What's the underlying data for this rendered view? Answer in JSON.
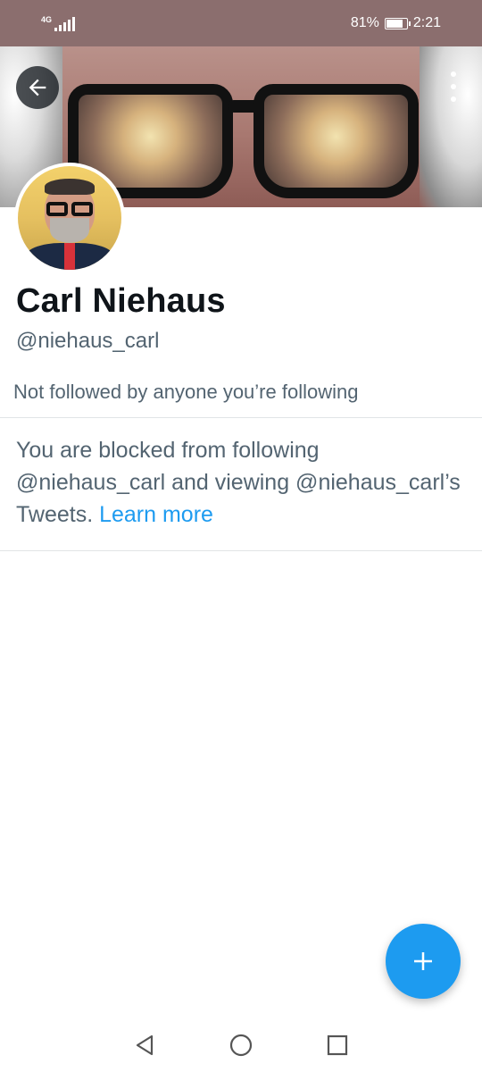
{
  "status_bar": {
    "network": "4G",
    "battery_percent": "81%",
    "battery_level": 0.81,
    "time": "2:21"
  },
  "profile": {
    "name": "Carl Niehaus",
    "handle": "@niehaus_carl",
    "followed_by_text": "Not followed by anyone you’re following"
  },
  "blocked_notice": {
    "message": "You are blocked from following @niehaus_carl and viewing @niehaus_carl’s Tweets.",
    "link_text": "Learn more"
  },
  "colors": {
    "accent": "#1d9bf0",
    "status_bar_bg": "#8b6e6e",
    "secondary_text": "#536471",
    "primary_text": "#0f1419"
  },
  "icons": {
    "back": "arrow-left-icon",
    "more": "more-vertical-icon",
    "compose": "plus-icon",
    "nav_back": "triangle-back-icon",
    "nav_home": "circle-home-icon",
    "nav_recents": "square-recents-icon"
  }
}
